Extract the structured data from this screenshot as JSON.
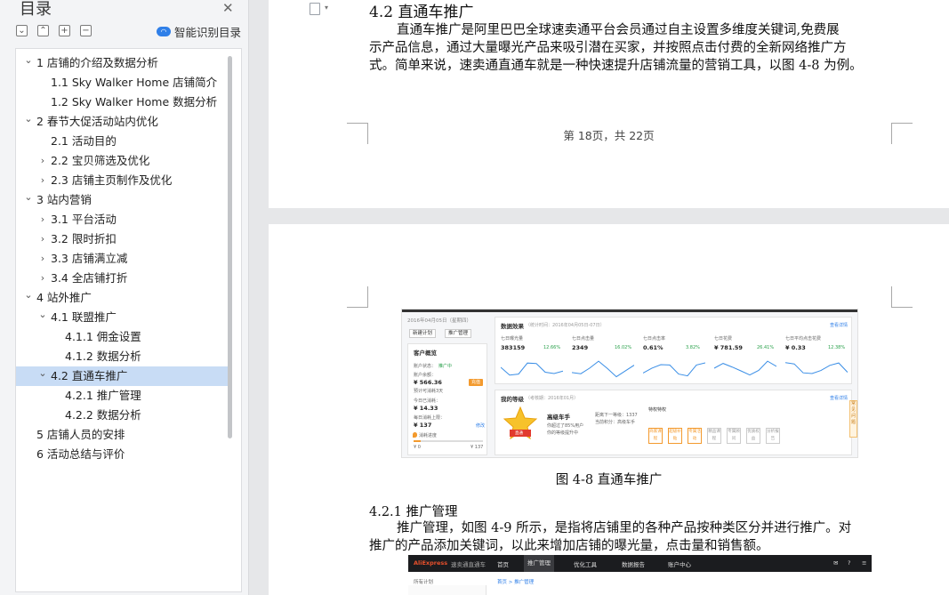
{
  "sidebar": {
    "title": "目录",
    "smart_toc_label": "智能识别目录",
    "toc": [
      {
        "label": "1 店铺的介绍及数据分析",
        "level": 0,
        "chevron": "open"
      },
      {
        "label": "1.1 Sky Walker Home 店铺简介",
        "level": 1,
        "chevron": "none"
      },
      {
        "label": "1.2 Sky Walker Home 数据分析",
        "level": 1,
        "chevron": "none"
      },
      {
        "label": "2 春节大促活动站内优化",
        "level": 0,
        "chevron": "open"
      },
      {
        "label": "2.1 活动目的",
        "level": 1,
        "chevron": "none"
      },
      {
        "label": "2.2 宝贝筛选及优化",
        "level": 1,
        "chevron": "closed"
      },
      {
        "label": "2.3 店铺主页制作及优化",
        "level": 1,
        "chevron": "closed"
      },
      {
        "label": "3 站内营销",
        "level": 0,
        "chevron": "open"
      },
      {
        "label": "3.1 平台活动",
        "level": 1,
        "chevron": "closed"
      },
      {
        "label": "3.2 限时折扣",
        "level": 1,
        "chevron": "closed"
      },
      {
        "label": "3.3 店铺满立减",
        "level": 1,
        "chevron": "closed"
      },
      {
        "label": "3.4 全店铺打折",
        "level": 1,
        "chevron": "closed"
      },
      {
        "label": "4 站外推广",
        "level": 0,
        "chevron": "open"
      },
      {
        "label": "4.1 联盟推广",
        "level": 1,
        "chevron": "open"
      },
      {
        "label": "4.1.1  佣金设置",
        "level": 2,
        "chevron": "none"
      },
      {
        "label": "4.1.2  数据分析",
        "level": 2,
        "chevron": "none"
      },
      {
        "label": "4.2 直通车推广",
        "level": 1,
        "chevron": "open",
        "selected": true
      },
      {
        "label": "4.2.1 推广管理",
        "level": 2,
        "chevron": "none"
      },
      {
        "label": "4.2.2 数据分析",
        "level": 2,
        "chevron": "none"
      },
      {
        "label": "5 店铺人员的安排",
        "level": 0,
        "chevron": "none"
      },
      {
        "label": "6 活动总结与评价",
        "level": 0,
        "chevron": "none"
      }
    ]
  },
  "document": {
    "page1": {
      "heading": "4.2 直通车推广",
      "paragraph": [
        "直通车推广是阿里巴巴全球速卖通平台会员通过自主设置多维度关键词,免费展",
        "示产品信息，通过大量曝光产品来吸引潜在买家，并按照点击付费的全新网络推广方",
        "式。简单来说，速卖通直通车就是一种快速提升店铺流量的营销工具，以图 4-8 为例。"
      ],
      "page_counter": "第 18页，共  22页"
    },
    "page2": {
      "caption": "图 4-8  直通车推广",
      "subheading": "4.2.1 推广管理",
      "paragraph": [
        "推广管理，如图 4-9 所示，是指将店铺里的各种产品按种类区分并进行推广。对",
        "推广的产品添加关键词，以此来增加店铺的曝光量，点击量和销售额。"
      ]
    }
  },
  "figure_4_8": {
    "date": "2016年04月05日（星期四）",
    "btn_new_plan": "新建计划",
    "btn_manage": "推广管理",
    "account_title": "客户概览",
    "account_status_label": "账户状态：",
    "account_status": "推广中",
    "balance_label": "账户余额：",
    "balance": "¥ 566.36",
    "recharge": "充值",
    "balance_note": "预计可消耗3天",
    "today_cost_label": "今日已消耗：",
    "today_cost": "¥ 14.33",
    "daily_limit_label": "每日消耗上限：",
    "daily_limit": "¥ 137",
    "edit": "修改",
    "limit_progress_label": "消耗进度",
    "limit_progress": 0.1,
    "limit_min": "¥ 0",
    "limit_max": "¥ 137",
    "data_title": "数据效果",
    "data_note": "（统计时间：2016年04月05日-07日）",
    "more": "查看详情",
    "metrics": [
      {
        "label": "七日曝光量",
        "value": "383159",
        "pct": "12.66%"
      },
      {
        "label": "七日点击量",
        "value": "2349",
        "pct": "16.02%"
      },
      {
        "label": "七日点击率",
        "value": "0.61%",
        "pct": "3.82%"
      },
      {
        "label": "七日花费",
        "value": "¥ 781.59",
        "pct": "26.41%"
      },
      {
        "label": "七日平均点击花费",
        "value": "¥ 0.33",
        "pct": "12.38%"
      }
    ],
    "grade_title": "我的等级",
    "grade_note": "（考核期：2016年01月）",
    "grade_name": "高级车手",
    "grade_badge": "直通",
    "grade_text": "你超过了85%用户",
    "grade_sub": "你的等级提升中",
    "grade_next": "距离下一等级：1337",
    "grade_score": "当前积分：高级车手",
    "privilege_label": "特权特权",
    "privileges": [
      "商家课程",
      "超级补贴",
      "专属活动",
      "精品课程",
      "专属顾问",
      "优质权益",
      "分析报告"
    ],
    "side_tab": "常见问题"
  },
  "figure_4_9": {
    "brand": "AliExpress",
    "brand_sub": "速卖通直通车",
    "nav": [
      "首页",
      "推广管理",
      "优化工具",
      "数据报告",
      "账户中心"
    ],
    "active_nav": "推广管理",
    "breadcrumb": "首页 > 推广管理",
    "side_label": "所有计划"
  }
}
